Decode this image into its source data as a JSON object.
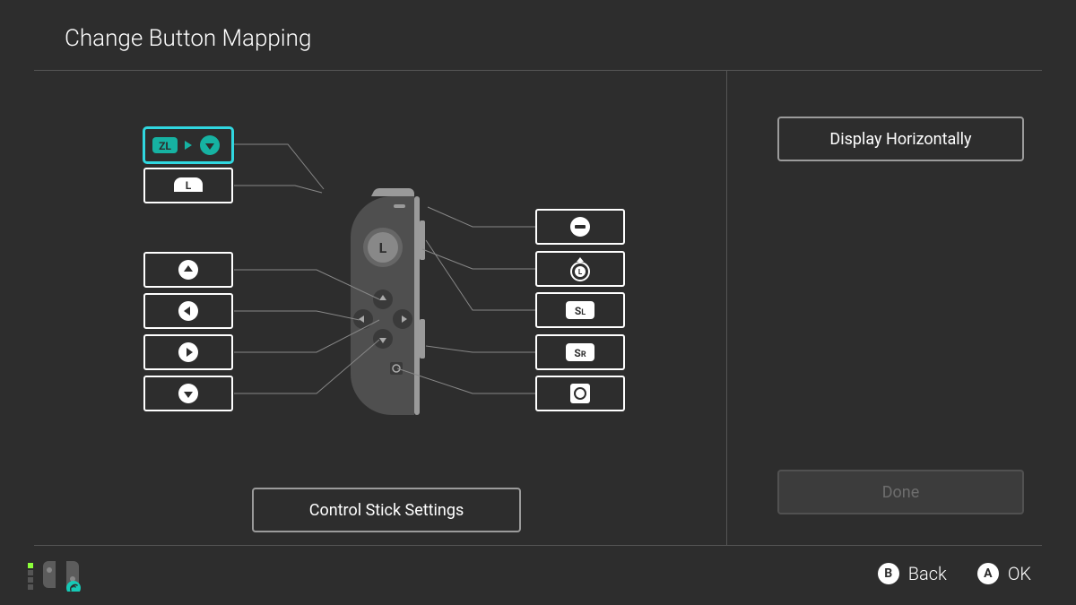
{
  "header": {
    "title": "Change Button Mapping"
  },
  "buttons_left": {
    "zl": {
      "label": "ZL",
      "remapped_to": "down"
    },
    "l": {
      "label": "L"
    },
    "up": {
      "dir": "up"
    },
    "left": {
      "dir": "left"
    },
    "right": {
      "dir": "right"
    },
    "down": {
      "dir": "down"
    }
  },
  "buttons_right": {
    "minus": {
      "label": "−"
    },
    "stick": {
      "label": "LStick"
    },
    "sl": {
      "label": "SL"
    },
    "sr": {
      "label": "SR"
    },
    "capture": {
      "label": "capture"
    }
  },
  "joycon_label": "L",
  "control_stick_btn": "Control Stick Settings",
  "panel": {
    "display_horiz": "Display Horizontally",
    "done": "Done"
  },
  "footer": {
    "back_key": "B",
    "back_label": "Back",
    "ok_key": "A",
    "ok_label": "OK"
  }
}
